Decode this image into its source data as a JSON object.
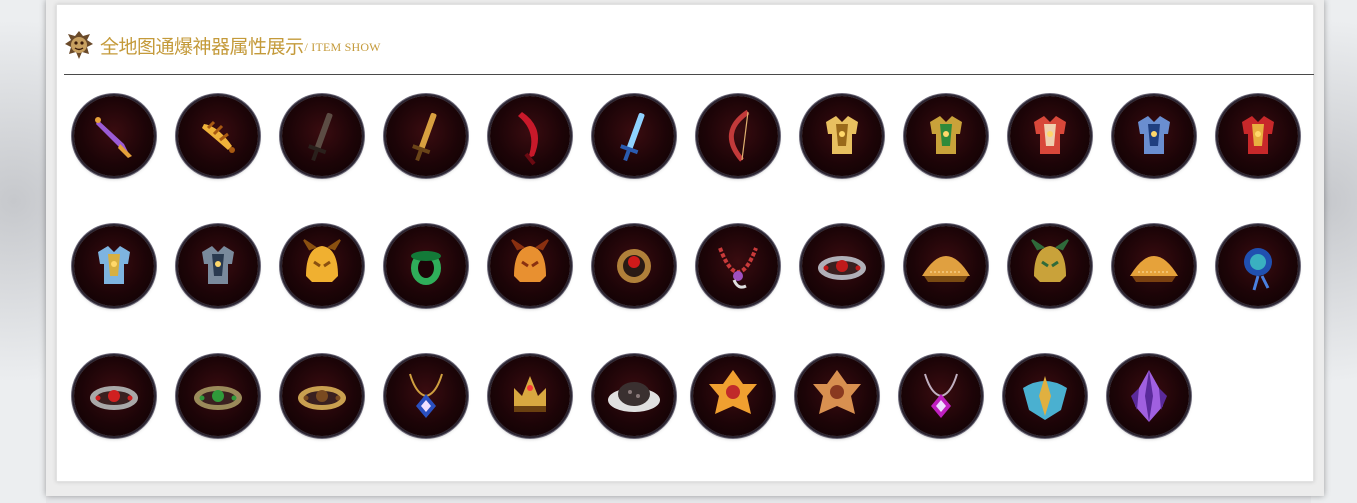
{
  "header": {
    "title": "全地图通爆神器属性展示",
    "subtitle": "/ ITEM SHOW"
  },
  "colors": {
    "accent": "#c49a3a",
    "item_bg": "#1c0407",
    "item_ring": "#6a6676"
  },
  "items": [
    {
      "name": "purple-dagger-icon",
      "kind": "dagger",
      "c1": "#9b5bd6",
      "c2": "#e5a13a"
    },
    {
      "name": "golden-blade-icon",
      "kind": "flame-sword",
      "c1": "#f0b33a",
      "c2": "#a85a12"
    },
    {
      "name": "dark-greatsword-icon",
      "kind": "long-sword",
      "c1": "#5c4c44",
      "c2": "#2a201c"
    },
    {
      "name": "golden-sword-icon",
      "kind": "long-sword",
      "c1": "#d8a040",
      "c2": "#6a4418"
    },
    {
      "name": "crimson-blade-icon",
      "kind": "curved-blade",
      "c1": "#c8192a",
      "c2": "#6a0a12"
    },
    {
      "name": "ice-sword-icon",
      "kind": "long-sword",
      "c1": "#8fd2ff",
      "c2": "#2a5bb0"
    },
    {
      "name": "red-bow-icon",
      "kind": "bow",
      "c1": "#c23a3a",
      "c2": "#e0b070"
    },
    {
      "name": "golden-armor-icon",
      "kind": "armor",
      "c1": "#e8c060",
      "c2": "#9a6a1a"
    },
    {
      "name": "jade-armor-icon",
      "kind": "armor",
      "c1": "#c9a23a",
      "c2": "#2f8a3a"
    },
    {
      "name": "red-robe-icon",
      "kind": "armor",
      "c1": "#d8483a",
      "c2": "#f0d0b0"
    },
    {
      "name": "blue-armor-icon",
      "kind": "armor",
      "c1": "#6a8ed0",
      "c2": "#1f3f80"
    },
    {
      "name": "crimson-armor-icon",
      "kind": "armor",
      "c1": "#c8282a",
      "c2": "#e8b040"
    },
    {
      "name": "azure-armor-icon",
      "kind": "armor",
      "c1": "#7eb4e0",
      "c2": "#d8b040"
    },
    {
      "name": "steel-armor-icon",
      "kind": "armor",
      "c1": "#7a8a9c",
      "c2": "#2a3a50"
    },
    {
      "name": "golden-helmet-icon",
      "kind": "helmet",
      "c1": "#f0b030",
      "c2": "#8a5010"
    },
    {
      "name": "jade-ring-icon",
      "kind": "ring",
      "c1": "#2fae5a",
      "c2": "#137a38"
    },
    {
      "name": "flame-helmet-icon",
      "kind": "helmet",
      "c1": "#e89030",
      "c2": "#8a3010"
    },
    {
      "name": "ruby-ring-icon",
      "kind": "gem-ring",
      "c1": "#b0803a",
      "c2": "#d01a1a"
    },
    {
      "name": "amethyst-necklace-icon",
      "kind": "necklace",
      "c1": "#c83a3a",
      "c2": "#a050c0"
    },
    {
      "name": "silver-bracelet-icon",
      "kind": "bracelet",
      "c1": "#b0b0b8",
      "c2": "#c01a1a"
    },
    {
      "name": "golden-boots-icon",
      "kind": "dome",
      "c1": "#e0a040",
      "c2": "#7a4a12"
    },
    {
      "name": "emerald-belt-icon",
      "kind": "helmet",
      "c1": "#c9a23a",
      "c2": "#2f6a3a"
    },
    {
      "name": "bronze-dome-icon",
      "kind": "dome",
      "c1": "#e6a23a",
      "c2": "#7a4010"
    },
    {
      "name": "sapphire-amulet-icon",
      "kind": "amulet",
      "c1": "#3ab0c0",
      "c2": "#2050b0"
    },
    {
      "name": "ruby-bracelet-icon",
      "kind": "bracelet",
      "c1": "#a8a8a8",
      "c2": "#d02020"
    },
    {
      "name": "jade-bracelet-icon",
      "kind": "bracelet",
      "c1": "#9a8a5a",
      "c2": "#2f9a3a"
    },
    {
      "name": "bronze-bracelet-icon",
      "kind": "bracelet",
      "c1": "#c9a050",
      "c2": "#7a4a20"
    },
    {
      "name": "sapphire-pendant-icon",
      "kind": "pendant",
      "c1": "#d0a040",
      "c2": "#2a50c0"
    },
    {
      "name": "golden-crown-icon",
      "kind": "crown",
      "c1": "#d8a840",
      "c2": "#6a4010"
    },
    {
      "name": "onyx-disc-icon",
      "kind": "disc",
      "c1": "#e0e0e0",
      "c2": "#3a3030"
    },
    {
      "name": "phoenix-crest-icon",
      "kind": "crest",
      "c1": "#f0a030",
      "c2": "#c02a2a"
    },
    {
      "name": "flame-crest-icon",
      "kind": "crest",
      "c1": "#d89050",
      "c2": "#8a3a20"
    },
    {
      "name": "violet-pendant-icon",
      "kind": "pendant",
      "c1": "#c0b0c0",
      "c2": "#c020c0"
    },
    {
      "name": "sky-emblem-icon",
      "kind": "emblem",
      "c1": "#4ab0d0",
      "c2": "#e0b040"
    },
    {
      "name": "amethyst-crystal-icon",
      "kind": "crystal",
      "c1": "#a060e0",
      "c2": "#5a2a9a"
    }
  ]
}
